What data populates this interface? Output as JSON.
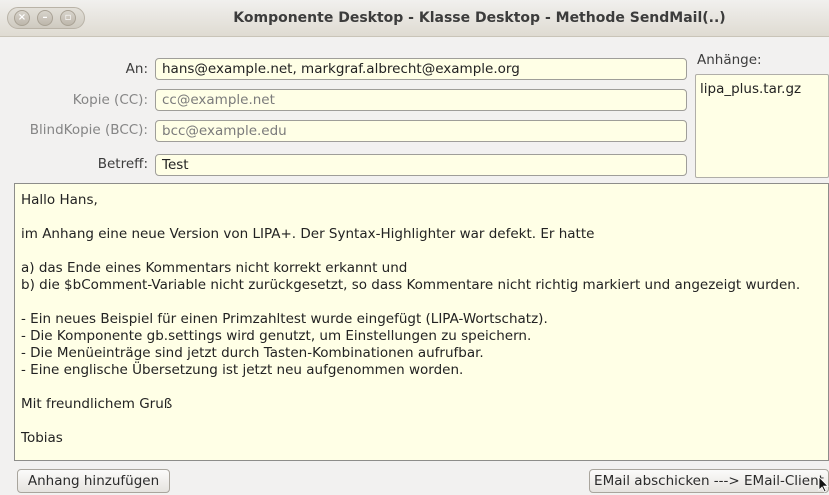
{
  "window": {
    "title": "Komponente Desktop - Klasse Desktop - Methode SendMail(..)",
    "close_glyph": "×",
    "minimize_glyph": "–",
    "maximize_glyph": "▫"
  },
  "form": {
    "to_label": "An:",
    "to_value": "hans@example.net,  markgraf.albrecht@example.org",
    "cc_label": "Kopie (CC):",
    "cc_value": "cc@example.net",
    "bcc_label": "BlindKopie (BCC):",
    "bcc_value": "bcc@example.edu",
    "subject_label": "Betreff:",
    "subject_value": "Test"
  },
  "attachments": {
    "label": "Anhänge:",
    "items": [
      "lipa_plus.tar.gz"
    ]
  },
  "body_lines": [
    "Hallo Hans,",
    "",
    "im Anhang eine neue Version von LIPA+. Der Syntax-Highlighter war defekt. Er hatte",
    "",
    "a) das Ende eines Kommentars nicht korrekt erkannt und",
    "b) die $bComment-Variable nicht zurückgesetzt, so dass Kommentare nicht richtig markiert und angezeigt wurden.",
    "",
    "- Ein neues Beispiel für einen Primzahltest wurde eingefügt (LIPA-Wortschatz).",
    "- Die Komponente gb.settings wird genutzt, um Einstellungen zu speichern.",
    "- Die Menüeinträge sind jetzt durch Tasten-Kombinationen aufrufbar.",
    "- Eine englische Übersetzung ist jetzt neu aufgenommen worden.",
    "",
    "Mit freundlichem Gruß",
    "",
    "Tobias"
  ],
  "buttons": {
    "add_attachment": "Anhang hinzufügen",
    "send": "EMail abschicken ---> EMail-Client"
  }
}
